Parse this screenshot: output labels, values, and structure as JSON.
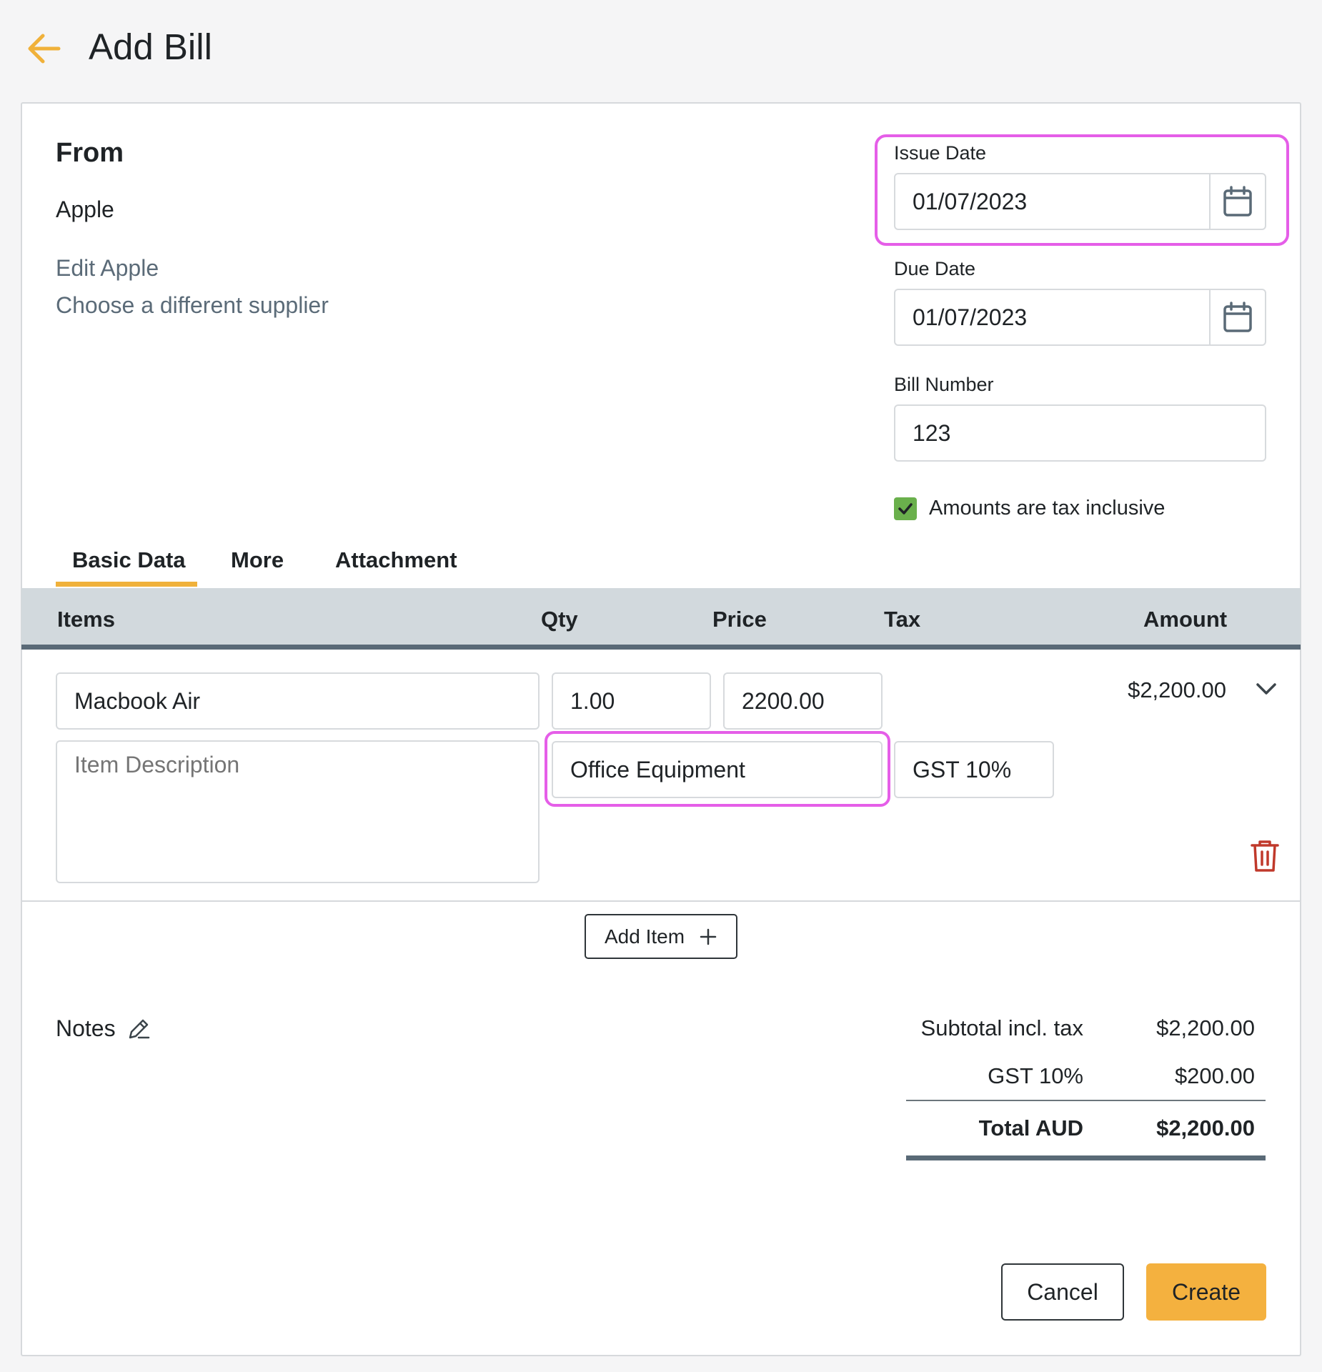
{
  "header": {
    "title": "Add Bill",
    "back_icon": "arrow-left-icon",
    "accent": "#f0b13a"
  },
  "from": {
    "title": "From",
    "supplier": "Apple",
    "edit_link": "Edit Apple",
    "change_link": "Choose a different supplier"
  },
  "issue_date": {
    "label": "Issue Date",
    "value": "01/07/2023"
  },
  "due_date": {
    "label": "Due Date",
    "value": "01/07/2023"
  },
  "bill_number": {
    "label": "Bill Number",
    "value": "123"
  },
  "tax_inclusive": {
    "label": "Amounts are tax inclusive",
    "checked": true
  },
  "tabs": [
    {
      "label": "Basic Data",
      "active": true
    },
    {
      "label": "More"
    },
    {
      "label": "Attachment"
    }
  ],
  "table": {
    "columns": {
      "items": "Items",
      "qty": "Qty",
      "price": "Price",
      "tax": "Tax",
      "amount": "Amount"
    },
    "rows": [
      {
        "item": "Macbook Air",
        "qty": "1.00",
        "price": "2200.00",
        "description_placeholder": "Item Description",
        "account": "Office Equipment",
        "tax": "GST 10%",
        "amount": "$2,200.00"
      }
    ]
  },
  "add_item_label": "Add Item",
  "notes_label": "Notes",
  "summary": {
    "subtotal_label": "Subtotal incl. tax",
    "subtotal_value": "$2,200.00",
    "gst_label": "GST 10%",
    "gst_value": "$200.00",
    "total_label": "Total AUD",
    "total_value": "$2,200.00"
  },
  "actions": {
    "cancel": "Cancel",
    "create": "Create"
  },
  "colors": {
    "highlight": "#e55ee8",
    "checkbox": "#6ab04c",
    "delete": "#c0392b",
    "primary_button": "#f4b13f"
  }
}
